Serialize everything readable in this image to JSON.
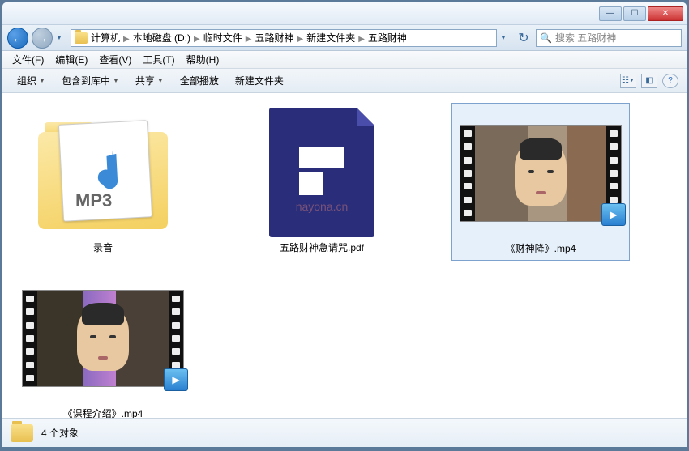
{
  "breadcrumb": [
    "计算机",
    "本地磁盘 (D:)",
    "临时文件",
    "五路财神",
    "新建文件夹",
    "五路财神"
  ],
  "search": {
    "placeholder": "搜索 五路财神"
  },
  "menu": {
    "file": "文件(F)",
    "edit": "编辑(E)",
    "view": "查看(V)",
    "tools": "工具(T)",
    "help": "帮助(H)"
  },
  "toolbar": {
    "organize": "组织",
    "include": "包含到库中",
    "share": "共享",
    "playall": "全部播放",
    "newfolder": "新建文件夹"
  },
  "items": [
    {
      "name": "录音",
      "type": "folder-mp3"
    },
    {
      "name": "五路财神急请咒.pdf",
      "type": "pdf"
    },
    {
      "name": "《财神降》.mp4",
      "type": "video",
      "selected": true,
      "bg": "vbg1"
    },
    {
      "name": "《课程介绍》.mp4",
      "type": "video",
      "bg": "vbg2"
    }
  ],
  "status": {
    "count": "4 个对象"
  },
  "watermark": "nayona.cn"
}
